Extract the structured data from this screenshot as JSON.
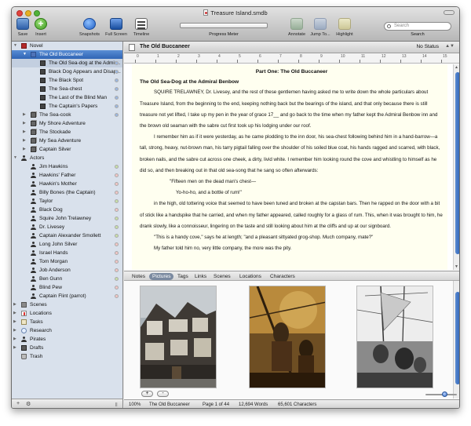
{
  "window": {
    "title": "Treasure Island.smdb"
  },
  "toolbar": {
    "save": "Save",
    "insert": "Insert",
    "snapshots": "Snapshots",
    "full_screen": "Full Screen",
    "timeline": "Timeline",
    "progress_meter": "Progress Meter",
    "annotate": "Annotate",
    "jump_to": "Jump To...",
    "highlight": "Highlight",
    "search_placeholder": "Search",
    "search_label": "Search"
  },
  "binder": {
    "items": [
      {
        "label": "Novel",
        "icon": "book-icon"
      },
      {
        "label": "The Old Buccaneer",
        "icon": "folder-icon"
      },
      {
        "label": "The Old Sea-dog at the Admir...",
        "icon": "page-icon"
      },
      {
        "label": "Black Dog Appears and Disap...",
        "icon": "page-icon"
      },
      {
        "label": "The Black Spot",
        "icon": "page-icon"
      },
      {
        "label": "The Sea-chest",
        "icon": "page-icon"
      },
      {
        "label": "The Last of the Blind Man",
        "icon": "page-icon"
      },
      {
        "label": "The Captain's Papers",
        "icon": "page-icon"
      },
      {
        "label": "The Sea-cook",
        "icon": "stack-icon"
      },
      {
        "label": "My Shore Adventure",
        "icon": "stack-icon"
      },
      {
        "label": "The Stockade",
        "icon": "stack-icon"
      },
      {
        "label": "My Sea Adventure",
        "icon": "stack-icon"
      },
      {
        "label": "Captain Silver",
        "icon": "stack-icon"
      },
      {
        "label": "Actors",
        "icon": "person-icon"
      },
      {
        "label": "Jim Hawkins",
        "icon": "person-icon"
      },
      {
        "label": "Hawkins' Father",
        "icon": "person-icon"
      },
      {
        "label": "Hawkin's Mother",
        "icon": "person-icon"
      },
      {
        "label": "Billy Bones (the Captain)",
        "icon": "person-icon"
      },
      {
        "label": "Taylor",
        "icon": "person-icon"
      },
      {
        "label": "Black Dog",
        "icon": "person-icon"
      },
      {
        "label": "Squire John Trelawney",
        "icon": "person-icon"
      },
      {
        "label": "Dr. Livesey",
        "icon": "person-icon"
      },
      {
        "label": "Captain Alexander Smollett",
        "icon": "person-icon"
      },
      {
        "label": "Long John Silver",
        "icon": "person-icon"
      },
      {
        "label": "Israel Hands",
        "icon": "person-icon"
      },
      {
        "label": "Tom Morgan",
        "icon": "person-icon"
      },
      {
        "label": "Job Anderson",
        "icon": "person-icon"
      },
      {
        "label": "Ben Gunn",
        "icon": "person-icon"
      },
      {
        "label": "Blind Pew",
        "icon": "person-icon"
      },
      {
        "label": "Captain Flint (parrot)",
        "icon": "person-icon"
      },
      {
        "label": "Scenes",
        "icon": "scenes-icon"
      },
      {
        "label": "Locations",
        "icon": "location-icon"
      },
      {
        "label": "Tasks",
        "icon": "tasks-icon"
      },
      {
        "label": "Research",
        "icon": "research-icon"
      },
      {
        "label": "Pirates",
        "icon": "person-icon"
      },
      {
        "label": "Drafts",
        "icon": "drafts-icon"
      },
      {
        "label": "Trash",
        "icon": "trash-icon"
      }
    ]
  },
  "editor": {
    "header_title": "The Old Buccaneer",
    "status": "No Status",
    "ruler_ticks": [
      "0",
      "1",
      "2",
      "3",
      "4",
      "5",
      "6",
      "7",
      "8",
      "9",
      "10",
      "11",
      "12",
      "13",
      "14",
      "15"
    ],
    "part_title": "Part One: The Old Buccaneer",
    "chapter_title": "The Old Sea-Dog at the Admiral Benbow",
    "p1": "SQUIRE TRELAWNEY, Dr. Livesey, and the rest of these gentlemen having asked me to write down the whole particulars about Treasure Island, from the beginning to the end, keeping nothing back but the bearings of the island, and that only because there is still treasure not yet lifted, I take up my pen in the year of grace 17__ and go back to the time when my father kept the Admiral Benbow inn and the brown old seaman with the sabre cut first took up his lodging under our roof.",
    "p2": "I remember him as if it were yesterday, as he came plodding to the inn door, his sea-chest following behind him in a hand-barrow—a tall, strong, heavy, nut-brown man, his tarry pigtail falling over the shoulder of his soiled blue coat, his hands ragged and scarred, with black, broken nails, and the sabre cut across one cheek, a dirty, livid white. I remember him looking round the cove and whistling to himself as he did so, and then breaking out in that old sea-song that he sang so often afterwards:",
    "verse1": "\"Fifteen men on the dead man's chest—",
    "verse2": "Yo-ho-ho, and a bottle of rum!\"",
    "p3": "in the high, old tottering voice that seemed to have been tuned and broken at the capstan bars. Then he rapped on the door with a bit of stick like a handspike that he carried, and when my father appeared, called roughly for a glass of rum. This, when it was brought to him, he drank slowly, like a connoisseur, lingering on the taste and still looking about him at the cliffs and up at our signboard.",
    "p4": "\"This is a handy cove,\" says he at length; \"and a pleasant sittyated grog-shop. Much company, mate?\"",
    "p5": "My father told him no, very little company, the more was the pity."
  },
  "inspector": {
    "tabs": [
      "Notes",
      "Pictures",
      "Tags",
      "Links",
      "Scenes",
      "Locations",
      "Characters"
    ],
    "active_tab": "Pictures",
    "add_label": "+",
    "remove_label": "-"
  },
  "footer": {
    "zoom": "100%",
    "doc_name": "The Old Buccaneer",
    "page": "Page 1 of 44",
    "words": "12,694 Words",
    "characters": "65,601 Characters"
  },
  "binder_footer": {
    "add": "+",
    "gear": "⚙",
    "split": "||"
  },
  "colors": {
    "selection": "#3b6fc0",
    "binder_bg": "#d9e1ec",
    "page_bg": "#fffff0"
  }
}
